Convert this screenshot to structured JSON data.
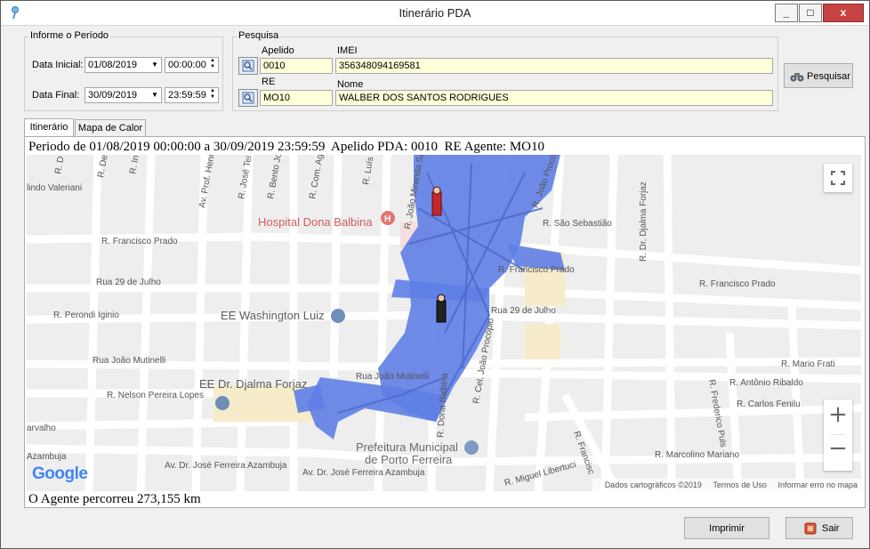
{
  "window": {
    "title": "Itinerário PDA",
    "minimize": "_",
    "maximize": "□",
    "close": "x"
  },
  "period_group": {
    "title": "Informe o Período",
    "start_label": "Data Inicial:",
    "start_date": "01/08/2019",
    "start_time": "00:00:00",
    "end_label": "Data Final:",
    "end_date": "30/09/2019",
    "end_time": "23:59:59"
  },
  "search_group": {
    "title": "Pesquisa",
    "apelido_label": "Apelido",
    "apelido_value": "0010",
    "imei_label": "IMEI",
    "imei_value": "356348094169581",
    "re_label": "RE",
    "re_value": "MO10",
    "nome_label": "Nome",
    "nome_value": "WALBER DOS SANTOS RODRIGUES"
  },
  "search_button": "Pesquisar",
  "tabs": [
    {
      "label": "Itinerário",
      "active": true
    },
    {
      "label": "Mapa de Calor",
      "active": false
    }
  ],
  "period_line": "Periodo de 01/08/2019 00:00:00 a 30/09/2019 23:59:59  Apelido PDA: 0010  RE Agente: MO10",
  "distance_line": "O Agente percorreu 273,155 km",
  "map": {
    "streets": [
      "R. Francisco Prado",
      "R. Francisco Prado",
      "R. Francisco Prado",
      "Rua 29 de Julho",
      "Rua 29 de Julho",
      "R. Perondi Iginio",
      "Rua João Mutinelli",
      "Rua João Mutinelli",
      "R. Nelson Pereira Lopes",
      "Av. Dr. José Ferreira Azambuja",
      "Av. Dr. José Ferreira Azambuja",
      "R. São Sebastião",
      "R. Dr. Djalma Forjaz",
      "R. Cel. João Procópio",
      "R. Dona Balbina",
      "R. Mario Frati",
      "R. Antônio Ribaldo",
      "R. Carlos Fenilu",
      "R. Frederico Puls",
      "R. Marcolino Mariano",
      "R. Miguel Libertuci",
      "R. João Procópio",
      "Av. Prof. Henr",
      "R. José Tei",
      "R. Bento Joã",
      "R. Com. Agr",
      "R. Luís C",
      "R. João Miranda Sa",
      "lindo Valeriani",
      "arvalho",
      "Azambuja",
      "R. Dez",
      "R. In",
      "R. D",
      "R. Francisc"
    ],
    "pois": [
      "Hospital Dona Balbina",
      "EE Washington Luiz",
      "EE Dr. Djalma Forjaz",
      "Prefeitura Municipal",
      "de Porto Ferreira"
    ],
    "logo": "Google",
    "attribution": [
      "Dados cartográficos ©2019",
      "Termos de Uso",
      "Informar erro no mapa"
    ],
    "colors": {
      "route": "#5f7ee6",
      "poi": "#e57373",
      "school": "#6d8fb8"
    }
  },
  "print_button": "Imprimir",
  "exit_button": "Sair"
}
